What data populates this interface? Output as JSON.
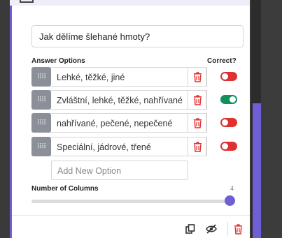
{
  "question": {
    "text": "Jak dělíme šlehané hmoty?"
  },
  "headers": {
    "answer_options": "Answer Options",
    "correct": "Correct?"
  },
  "options": [
    {
      "text": "Lehké, těžké, jiné",
      "correct": false
    },
    {
      "text": "Zvláštní, lehké, těžké, nahřívané",
      "correct": true
    },
    {
      "text": "nahřívané, pečené, nepečené",
      "correct": false
    },
    {
      "text": "Speciální, jádrové, třené",
      "correct": false
    }
  ],
  "add_option": {
    "placeholder": "Add New Option"
  },
  "columns": {
    "label": "Number of Columns",
    "value": "4",
    "level_fraction": 1.0
  },
  "colors": {
    "accent": "#6f5fd6",
    "danger": "#e03131",
    "success": "#12915c"
  },
  "icons": {
    "drag": "drag-handle-icon",
    "delete": "trash-icon",
    "duplicate": "copy-icon",
    "hide": "eye-off-icon"
  }
}
